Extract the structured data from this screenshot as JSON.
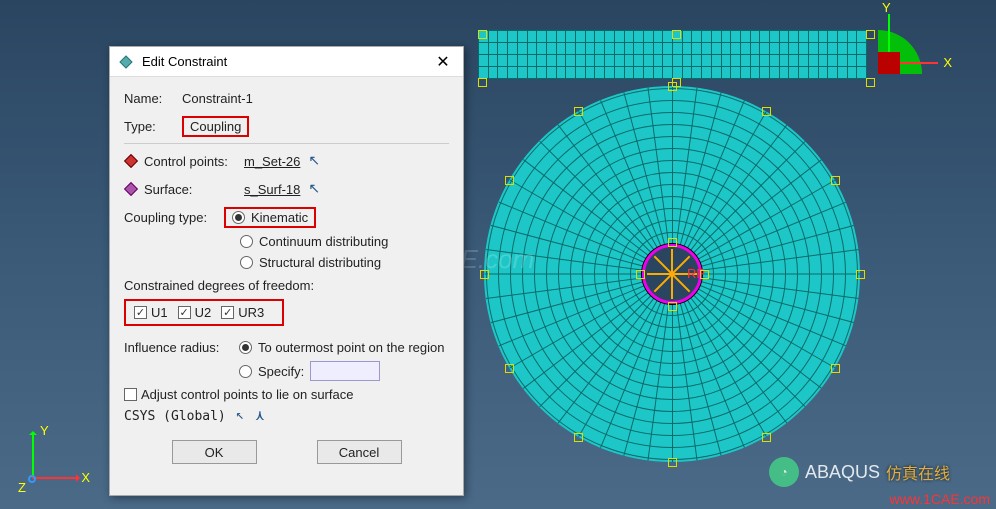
{
  "dialog": {
    "title": "Edit Constraint",
    "name_label": "Name:",
    "name_value": "Constraint-1",
    "type_label": "Type:",
    "type_value": "Coupling",
    "control_points_label": "Control points:",
    "control_points_value": "m_Set-26",
    "surface_label": "Surface:",
    "surface_value": "s_Surf-18",
    "coupling_type_label": "Coupling type:",
    "coupling_options": {
      "kinematic": "Kinematic",
      "continuum": "Continuum distributing",
      "structural": "Structural distributing"
    },
    "coupling_selected": "kinematic",
    "dof_label": "Constrained degrees of freedom:",
    "dof": {
      "u1": "U1",
      "u2": "U2",
      "ur3": "UR3"
    },
    "influence_label": "Influence radius:",
    "influence_options": {
      "outermost": "To outermost point on the region",
      "specify": "Specify:"
    },
    "influence_selected": "outermost",
    "specify_value": "",
    "adjust_label": "Adjust control points to lie on surface",
    "csys_label": "CSYS (Global)",
    "ok": "OK",
    "cancel": "Cancel"
  },
  "viewport": {
    "axis_x": "X",
    "axis_y": "Y",
    "axis_z": "Z",
    "rp_label": "RP",
    "logo_text": "ABAQUS",
    "site_url": "www.1CAE.com"
  },
  "watermark": "1CAE.com",
  "overlay_text": "仿真在线"
}
